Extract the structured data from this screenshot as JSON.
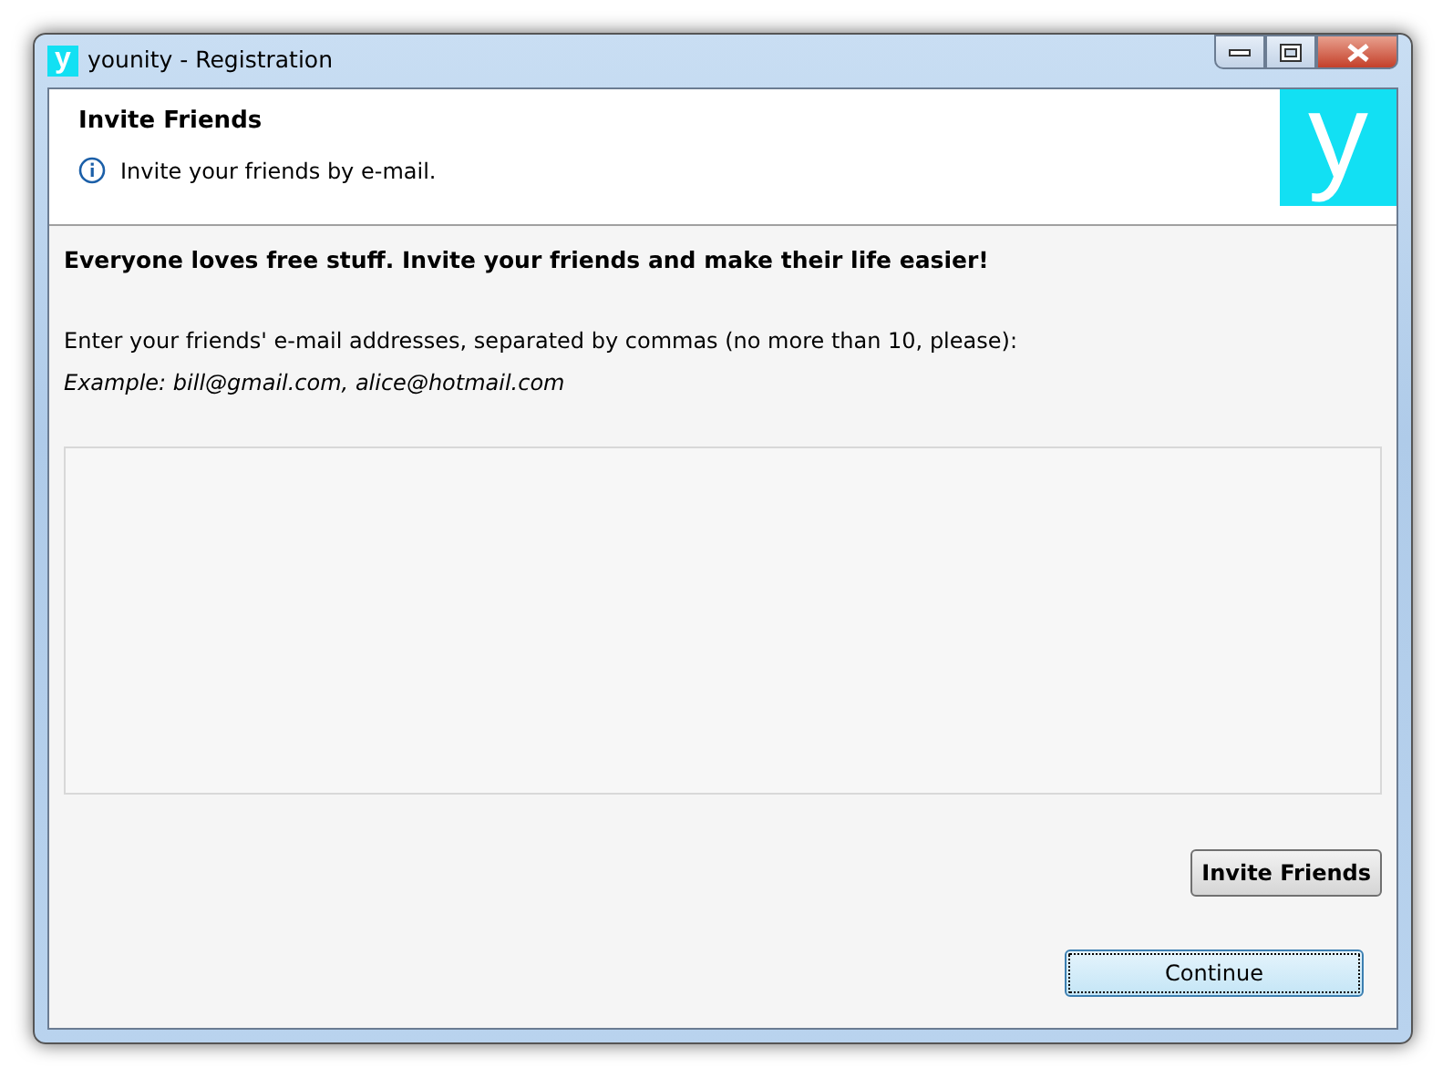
{
  "window": {
    "icon_letter": "y",
    "title": "younity - Registration"
  },
  "header": {
    "title": "Invite Friends",
    "info": "Invite your friends by e-mail.",
    "logo_letter": "y"
  },
  "body": {
    "headline": "Everyone loves free stuff. Invite your friends and make their life easier!",
    "instruction": "Enter your friends' e-mail addresses, separated by commas (no more than 10, please):",
    "example": "Example: bill@gmail.com, alice@hotmail.com"
  },
  "invite_button": "Invite Friends",
  "continue_button": "Continue"
}
